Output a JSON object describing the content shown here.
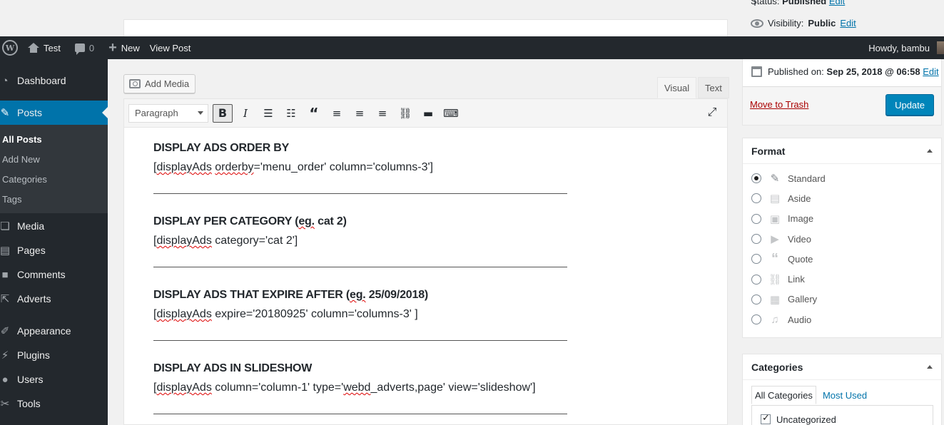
{
  "top": {
    "status_label": "Status:",
    "status_value": "Published",
    "status_edit": "Edit",
    "visibility_label": "Visibility:",
    "visibility_value": "Public",
    "visibility_edit": "Edit"
  },
  "adminbar": {
    "site_name": "Test",
    "comments_count": "0",
    "new_label": "New",
    "view_post": "View Post",
    "howdy": "Howdy, bambu"
  },
  "sidebar": {
    "items": [
      {
        "label": "Dashboard",
        "icon": "dashboard-icon"
      },
      {
        "label": "Posts",
        "icon": "pin-icon"
      },
      {
        "label": "Media",
        "icon": "media-icon"
      },
      {
        "label": "Pages",
        "icon": "pages-icon"
      },
      {
        "label": "Comments",
        "icon": "comments-icon"
      },
      {
        "label": "Adverts",
        "icon": "external-icon"
      },
      {
        "label": "Appearance",
        "icon": "brush-icon"
      },
      {
        "label": "Plugins",
        "icon": "plugin-icon"
      },
      {
        "label": "Users",
        "icon": "users-icon"
      },
      {
        "label": "Tools",
        "icon": "tools-icon"
      }
    ],
    "submenu": [
      "All Posts",
      "Add New",
      "Categories",
      "Tags"
    ]
  },
  "editor": {
    "add_media": "Add Media",
    "tab_visual": "Visual",
    "tab_text": "Text",
    "format_select": "Paragraph",
    "blocks": [
      {
        "heading": "DISPLAY ADS ORDER BY",
        "code_a": "[",
        "code_sp": "displayAds",
        "code_sp2": "orderby",
        "code_b": "='menu_order' column='columns-3']"
      },
      {
        "heading_a": "DISPLAY PER CATEGORY (",
        "heading_sp": "eg.",
        "heading_b": " cat 2)",
        "code_a": "[",
        "code_sp": "displayAds",
        "code_b": " category='cat 2']"
      },
      {
        "heading_a": "DISPLAY ADS THAT EXPIRE AFTER (",
        "heading_sp": "eg.",
        "heading_b": " 25/09/2018)",
        "code_a": "[",
        "code_sp": "displayAds",
        "code_b": " expire='20180925' column='columns-3' ]"
      },
      {
        "heading": "DISPLAY ADS IN SLIDESHOW",
        "code_a": "[",
        "code_sp": "displayAds",
        "code_b": " column='column-1' type='",
        "code_sp2": "webd",
        "code_c": "_adverts,page' view='slideshow']"
      }
    ]
  },
  "publish": {
    "published_on_label": "Published on:",
    "published_on_value": "Sep 25, 2018 @ 06:58",
    "edit": "Edit",
    "trash": "Move to Trash",
    "update": "Update"
  },
  "format_box": {
    "title": "Format",
    "options": [
      {
        "label": "Standard",
        "icon": "pin-icon",
        "checked": true
      },
      {
        "label": "Aside",
        "icon": "aside-icon",
        "checked": false
      },
      {
        "label": "Image",
        "icon": "image-icon",
        "checked": false
      },
      {
        "label": "Video",
        "icon": "video-icon",
        "checked": false
      },
      {
        "label": "Quote",
        "icon": "quote-icon",
        "checked": false
      },
      {
        "label": "Link",
        "icon": "link-icon",
        "checked": false
      },
      {
        "label": "Gallery",
        "icon": "gallery-icon",
        "checked": false
      },
      {
        "label": "Audio",
        "icon": "audio-icon",
        "checked": false
      }
    ]
  },
  "categories_box": {
    "title": "Categories",
    "tab_all": "All Categories",
    "tab_most_used": "Most Used",
    "item": "Uncategorized"
  },
  "colors": {
    "adminbar_bg": "#23282d",
    "accent": "#0073aa",
    "button": "#0085ba",
    "trash": "#a00"
  }
}
